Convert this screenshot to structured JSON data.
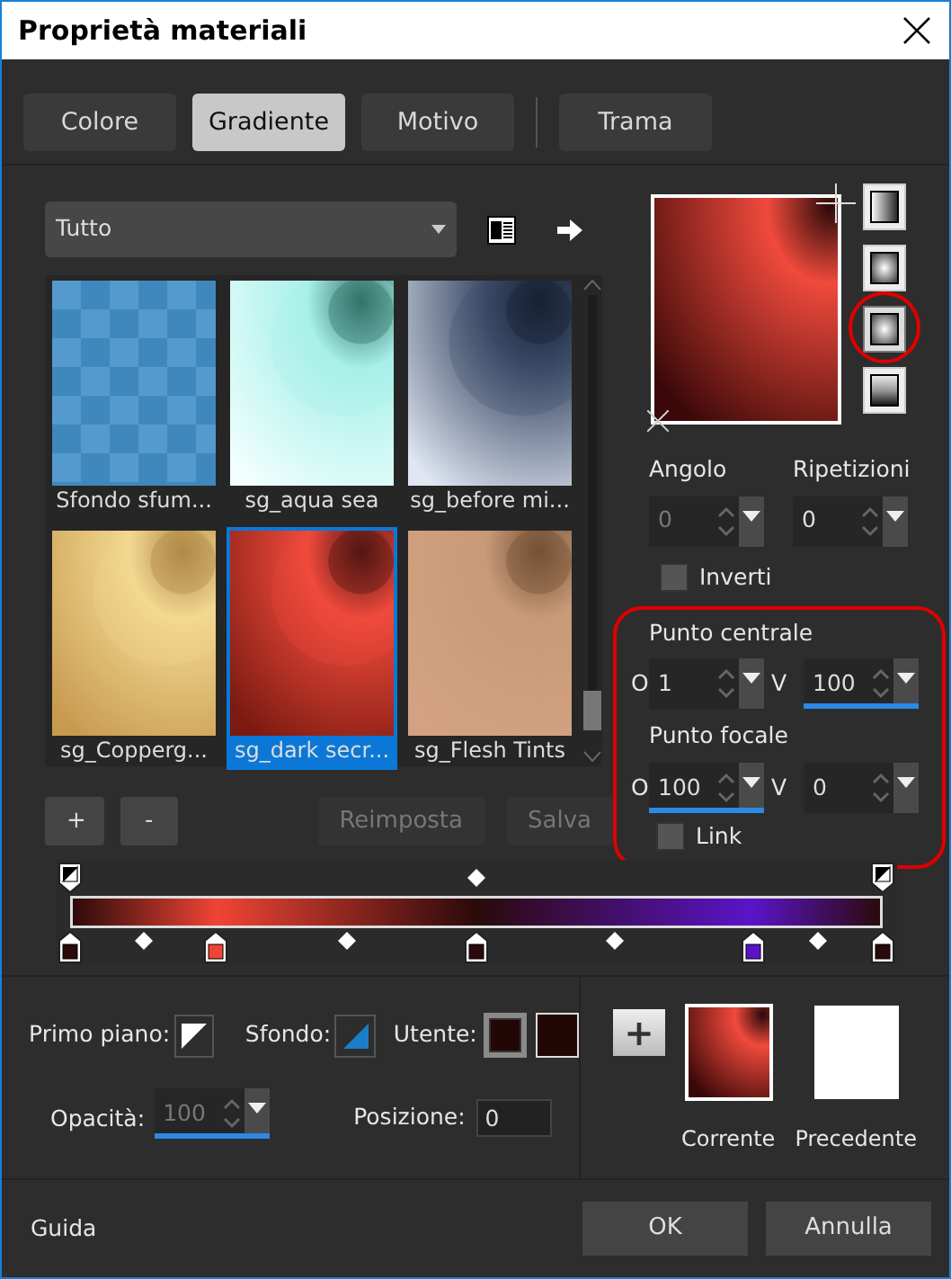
{
  "window": {
    "title": "Proprietà materiali"
  },
  "tabs": [
    {
      "label": "Colore",
      "selected": false
    },
    {
      "label": "Gradiente",
      "selected": true
    },
    {
      "label": "Motivo",
      "selected": false
    },
    {
      "label": "Trama",
      "selected": false
    }
  ],
  "category_dropdown": {
    "value": "Tutto"
  },
  "gallery": [
    {
      "label": "Sfondo sfum...",
      "selected": false,
      "kind": "picture"
    },
    {
      "label": "sg_aqua sea",
      "selected": false,
      "kind": "picture"
    },
    {
      "label": "sg_before mi...",
      "selected": false,
      "kind": "picture"
    },
    {
      "label": "sg_Copperg...",
      "selected": false,
      "kind": "picture"
    },
    {
      "label": "sg_dark secr...",
      "selected": true,
      "kind": "picture"
    },
    {
      "label": "sg_Flesh Tints",
      "selected": false,
      "kind": "picture"
    }
  ],
  "gradient_types": [
    {
      "kind": "linear",
      "selected": false,
      "highlighted": false
    },
    {
      "kind": "rectangular",
      "selected": false,
      "highlighted": false
    },
    {
      "kind": "radial",
      "selected": true,
      "highlighted": true
    },
    {
      "kind": "sunburst",
      "selected": false,
      "highlighted": false
    }
  ],
  "angle": {
    "label": "Angolo",
    "value": "0",
    "disabled": true,
    "active": false
  },
  "repeats": {
    "label": "Ripetizioni",
    "value": "0",
    "disabled": false,
    "active": false
  },
  "invert": {
    "label": "Inverti",
    "checked": false
  },
  "points_group": {
    "highlighted": true,
    "center": {
      "label": "Punto centrale",
      "h": {
        "prefix": "O",
        "value": "1",
        "active": false
      },
      "v": {
        "prefix": "V",
        "value": "100",
        "active": true
      }
    },
    "focal": {
      "label": "Punto focale",
      "h": {
        "prefix": "O",
        "value": "100",
        "active": true
      },
      "v": {
        "prefix": "V",
        "value": "0",
        "active": false
      }
    },
    "link": {
      "label": "Link",
      "checked": false
    }
  },
  "stop_buttons": [
    {
      "label": "+"
    },
    {
      "label": "-"
    }
  ],
  "preset_buttons": [
    {
      "label": "Reimposta",
      "disabled": true
    },
    {
      "label": "Salva",
      "disabled": true
    }
  ],
  "gradient_editor": {
    "opacity_stops": [
      {
        "level": 0
      },
      {
        "level": 1
      }
    ],
    "color_stops": [
      {
        "level": 0,
        "color": "#2a0a0a"
      },
      {
        "level": 0.18,
        "color": "#f04434"
      },
      {
        "level": 0.5,
        "color": "#2a0a0a"
      },
      {
        "level": 0.84,
        "color": "#5a14c8"
      },
      {
        "level": 1,
        "color": "#2a0a0a"
      }
    ]
  },
  "stop_settings": {
    "foreground_label": "Primo piano:",
    "background_label": "Sfondo:",
    "user_label": "Utente:",
    "user_swatches": [
      {
        "color": "#230606",
        "selected": true
      },
      {
        "color": "#230606",
        "selected": false
      }
    ],
    "opacity": {
      "label": "Opacità:",
      "value": "100",
      "disabled": true,
      "active": true
    },
    "position": {
      "label": "Posizione:",
      "value": "0"
    }
  },
  "add_button": {
    "label": "+"
  },
  "swatches": [
    {
      "label": "Corrente",
      "kind": "gradient"
    },
    {
      "label": "Precedente",
      "kind": "blank"
    }
  ],
  "footer": {
    "help": "Guida",
    "buttons": [
      {
        "label": "OK"
      },
      {
        "label": "Annulla"
      }
    ]
  }
}
